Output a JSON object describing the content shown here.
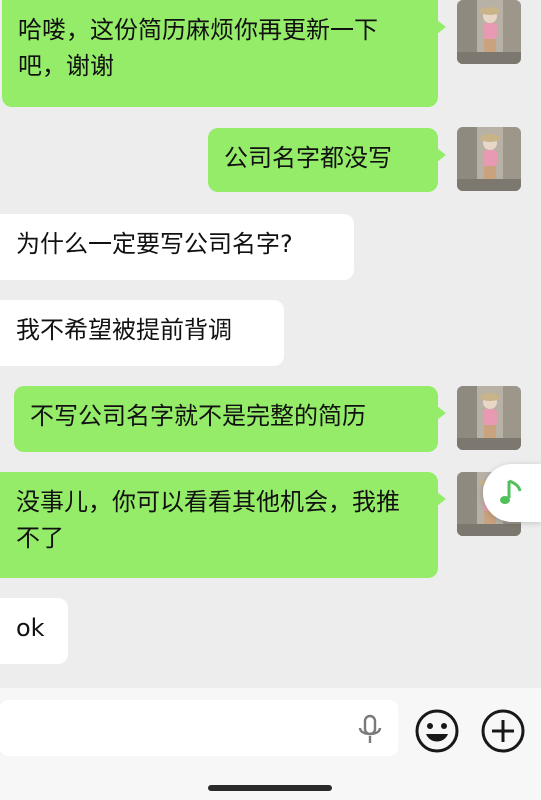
{
  "messages": [
    {
      "side": "out",
      "text": "哈喽，这份简历麻烦你再更新一下吧，谢谢"
    },
    {
      "side": "out",
      "text": "公司名字都没写"
    },
    {
      "side": "in",
      "text": "为什么一定要写公司名字?"
    },
    {
      "side": "in",
      "text": "我不希望被提前背调"
    },
    {
      "side": "out",
      "text": "不写公司名字就不是完整的简历"
    },
    {
      "side": "out",
      "text": "没事儿，你可以看看其他机会，我推不了"
    },
    {
      "side": "in",
      "text": "ok"
    }
  ],
  "icons": {
    "avatar": "avatar-photo",
    "floating": "music-note-icon",
    "mic": "microphone-icon",
    "emoji": "emoji-icon",
    "plus": "plus-icon"
  },
  "colors": {
    "outgoing_bubble": "#95ec69",
    "incoming_bubble": "#ffffff",
    "chat_background": "#ededed",
    "accent_green": "#4fc05a"
  }
}
